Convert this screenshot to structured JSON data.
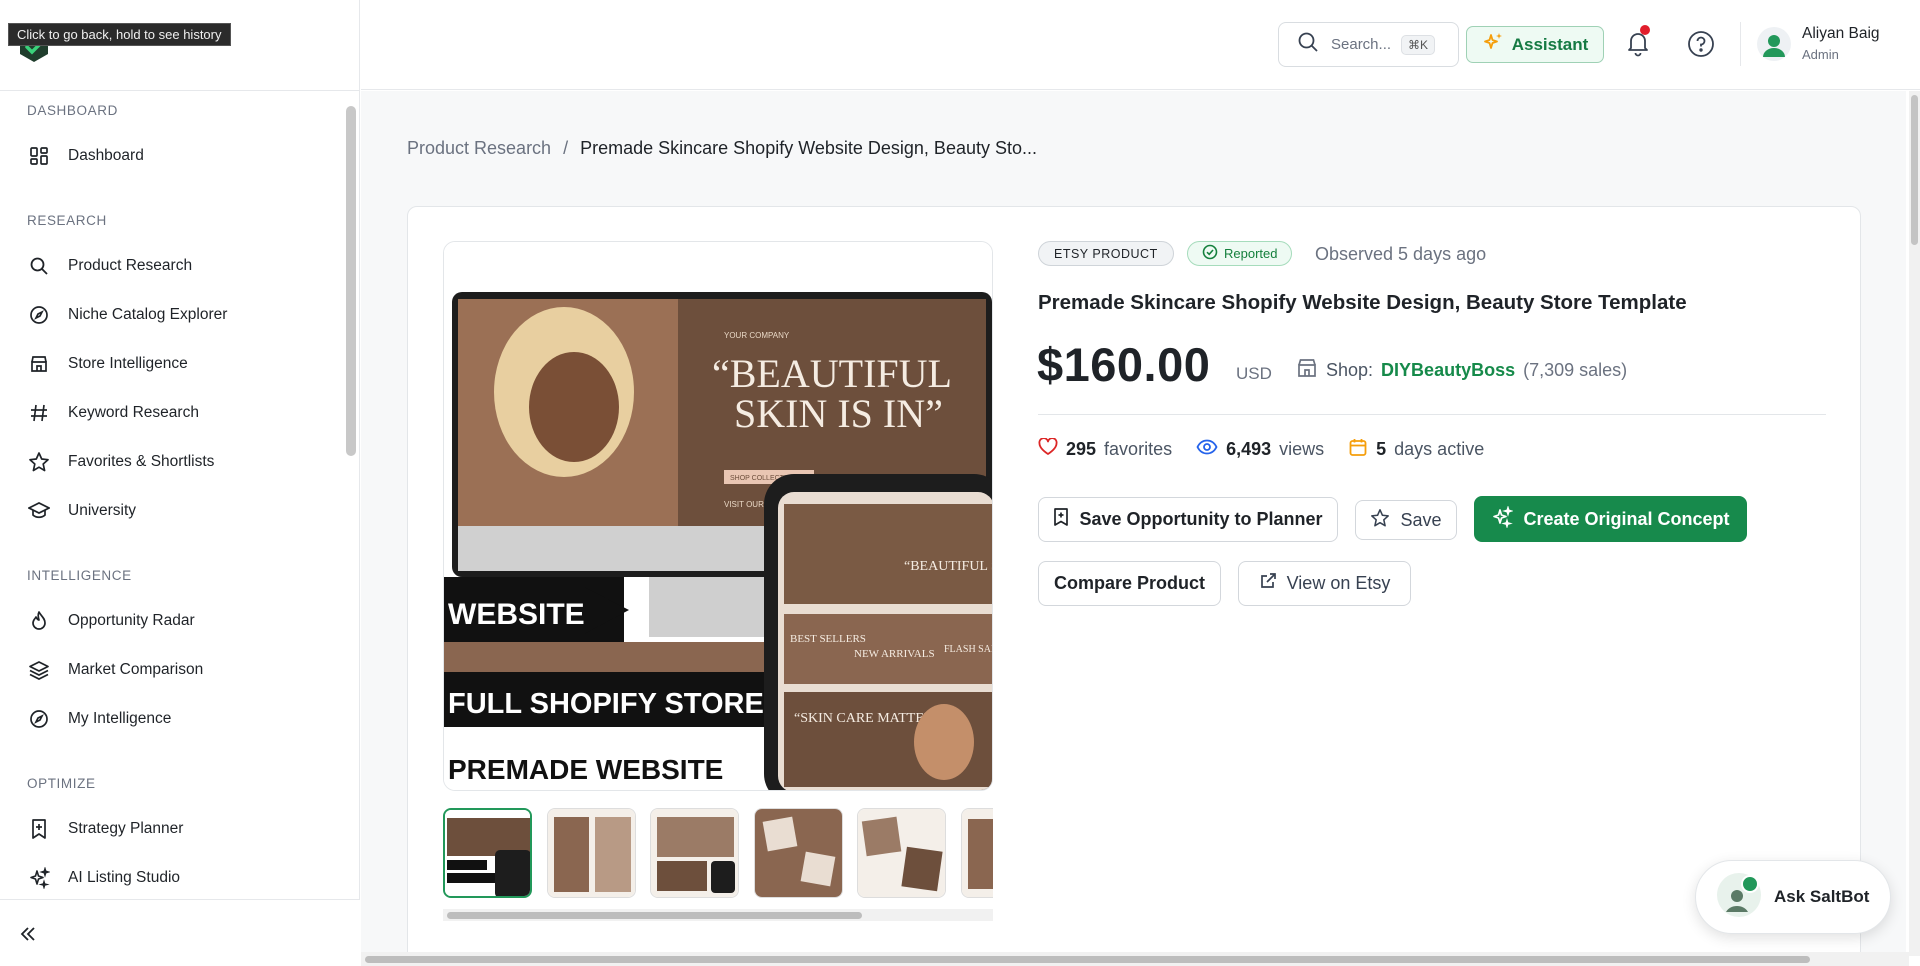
{
  "tooltip": "Click to go back, hold to see history",
  "sidebar": {
    "sections": [
      {
        "title": "DASHBOARD",
        "items": [
          {
            "label": "Dashboard",
            "icon": "grid-icon"
          }
        ]
      },
      {
        "title": "RESEARCH",
        "items": [
          {
            "label": "Product Research",
            "icon": "search-icon"
          },
          {
            "label": "Niche Catalog Explorer",
            "icon": "compass-icon"
          },
          {
            "label": "Store Intelligence",
            "icon": "store-icon"
          },
          {
            "label": "Keyword Research",
            "icon": "hash-icon"
          },
          {
            "label": "Favorites & Shortlists",
            "icon": "star-icon"
          },
          {
            "label": "University",
            "icon": "graduation-cap-icon"
          }
        ]
      },
      {
        "title": "INTELLIGENCE",
        "items": [
          {
            "label": "Opportunity Radar",
            "icon": "flame-icon"
          },
          {
            "label": "Market Comparison",
            "icon": "layers-icon"
          },
          {
            "label": "My Intelligence",
            "icon": "compass-icon"
          }
        ]
      },
      {
        "title": "OPTIMIZE",
        "items": [
          {
            "label": "Strategy Planner",
            "icon": "bookmark-plus-icon"
          },
          {
            "label": "AI Listing Studio",
            "icon": "sparkles-icon"
          }
        ]
      }
    ]
  },
  "header": {
    "search_placeholder": "Search...",
    "search_shortcut": "⌘K",
    "assistant_label": "Assistant",
    "user": {
      "name": "Aliyan Baig",
      "role": "Admin"
    }
  },
  "breadcrumb": {
    "parent": "Product Research",
    "separator": "/",
    "current": "Premade Skincare Shopify Website Design, Beauty Sto..."
  },
  "product": {
    "badge_source": "ETSY PRODUCT",
    "badge_status": "Reported",
    "observed": "Observed 5 days ago",
    "title": "Premade Skincare Shopify Website Design, Beauty Store Template",
    "price": "$160.00",
    "currency": "USD",
    "shop_label": "Shop:",
    "shop_name": "DIYBeautyBoss",
    "shop_sales": "(7,309 sales)",
    "favorites_count": "295",
    "favorites_label": "favorites",
    "views_count": "6,493",
    "views_label": "views",
    "days_count": "5",
    "days_label": "days active",
    "image_text": {
      "company": "YOUR COMPANY",
      "headline_1": "“BEAUTIFUL",
      "headline_2": "SKIN IS IN”",
      "shop_btn": "SHOP COLLECTION →",
      "visit": "VISIT OUR WEBSITE",
      "website": "WEBSITE",
      "full_store": "FULL SHOPIFY STORE",
      "premade": "PREMADE WEBSITE",
      "phone_head": "“BEAUTIFUL SKIN IS IN”",
      "best_sellers": "BEST SELLERS",
      "new_arrivals": "NEW ARRIVALS",
      "flash_sale": "FLASH SALE",
      "skincare": "“SKIN CARE MATTERS”"
    }
  },
  "actions": {
    "save_planner": "Save Opportunity to Planner",
    "save": "Save",
    "create_concept": "Create Original Concept",
    "compare": "Compare Product",
    "view_etsy": "View on Etsy"
  },
  "saltbot": {
    "label": "Ask SaltBot"
  },
  "colors": {
    "accent": "#178a4c",
    "brand_green": "#168a4a",
    "notification": "#e11d2b",
    "image_brown": "#7a5a44"
  }
}
